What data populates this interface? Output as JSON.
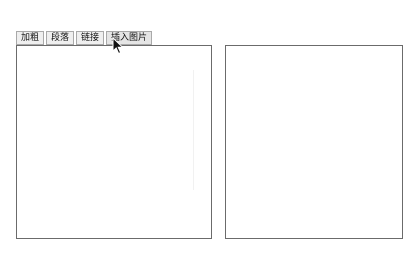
{
  "toolbar": {
    "bold": "加粗",
    "paragraph": "段落",
    "link": "链接",
    "insert_image": "插入图片"
  },
  "editor": {
    "left_content": "",
    "right_content": ""
  },
  "icons": {
    "cursor": "arrow-pointer-icon"
  }
}
